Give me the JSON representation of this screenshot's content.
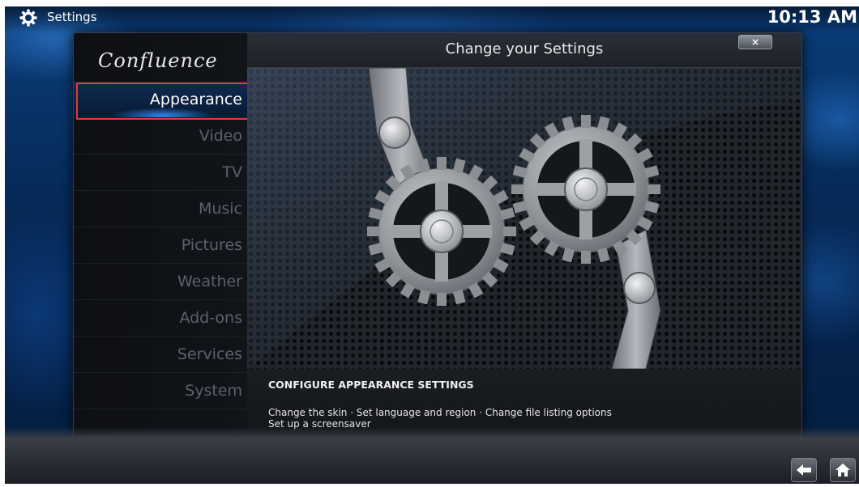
{
  "header": {
    "icon": "gear-icon",
    "title": "Settings",
    "clock": "10:13 AM"
  },
  "sidebar": {
    "brand": "Confluence",
    "items": [
      {
        "label": "Appearance",
        "selected": true
      },
      {
        "label": "Video"
      },
      {
        "label": "TV"
      },
      {
        "label": "Music"
      },
      {
        "label": "Pictures"
      },
      {
        "label": "Weather"
      },
      {
        "label": "Add-ons"
      },
      {
        "label": "Services"
      },
      {
        "label": "System"
      }
    ]
  },
  "content": {
    "title": "Change your Settings",
    "close_label": "×",
    "artwork_icon": "gears-artwork",
    "info": {
      "heading": "CONFIGURE APPEARANCE SETTINGS",
      "line1": "Change the skin · Set language and region · Change file listing options",
      "line2": "Set up a screensaver"
    }
  },
  "footer": {
    "back_icon": "back-arrow-icon",
    "home_icon": "home-icon"
  },
  "colors": {
    "accent": "#1e6fd0",
    "highlight_border": "#e03a3a",
    "background": "#062a58"
  }
}
